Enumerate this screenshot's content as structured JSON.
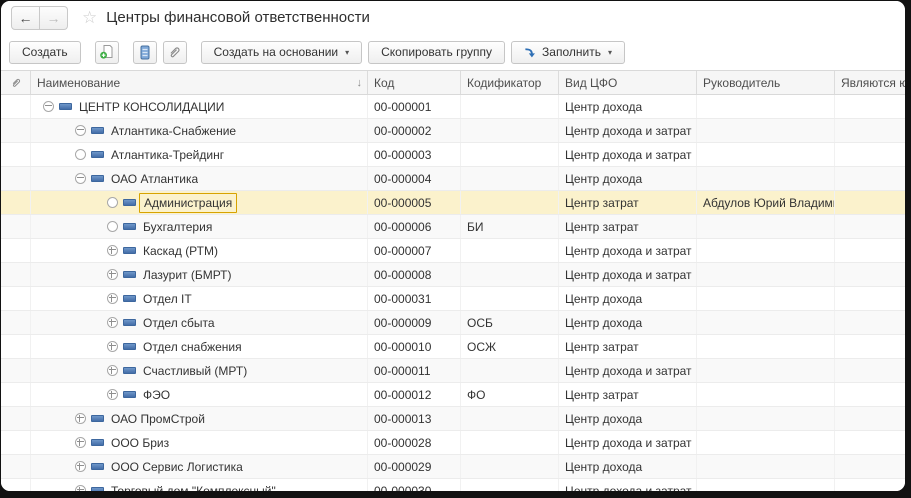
{
  "window": {
    "title": "Центры финансовой ответственности"
  },
  "icons": {
    "back_arrow": "←",
    "forward_arrow": "→",
    "favorite_star": "☆",
    "dropdown_caret": "▾",
    "sort_descending": "↓",
    "attachment": "paperclip-icon",
    "create_group_doc": "document-with-green-plus-icon",
    "list_report": "blue-list-icon",
    "fill": "blue-curved-arrow-icon"
  },
  "toolbar": {
    "create_label": "Создать",
    "create_based_on_label": "Создать на основании",
    "copy_group_label": "Скопировать группу",
    "fill_label": "Заполнить"
  },
  "table": {
    "columns": [
      "",
      "Наименование",
      "Код",
      "Кодификатор",
      "Вид ЦФО",
      "Руководитель",
      "Являются юридическим лицом",
      ""
    ],
    "rows": [
      {
        "name": "ЦЕНТР КОНСОЛИДАЦИИ",
        "level": 1,
        "expander": "minus",
        "code": "00-000001",
        "codifier": "",
        "cfo_type": "Центр дохода",
        "manager": "",
        "selected": false
      },
      {
        "name": "Атлантика-Снабжение",
        "level": 2,
        "expander": "minus",
        "code": "00-000002",
        "codifier": "",
        "cfo_type": "Центр дохода и затрат",
        "manager": "",
        "selected": false
      },
      {
        "name": "Атлантика-Трейдинг",
        "level": 2,
        "expander": "leaf",
        "code": "00-000003",
        "codifier": "",
        "cfo_type": "Центр дохода и затрат",
        "manager": "",
        "selected": false
      },
      {
        "name": "ОАО Атлантика",
        "level": 2,
        "expander": "minus",
        "code": "00-000004",
        "codifier": "",
        "cfo_type": "Центр дохода",
        "manager": "",
        "selected": false
      },
      {
        "name": "Администрация",
        "level": 3,
        "expander": "leaf",
        "code": "00-000005",
        "codifier": "",
        "cfo_type": "Центр затрат",
        "manager": "Абдулов Юрий Владими…",
        "selected": true
      },
      {
        "name": "Бухгалтерия",
        "level": 3,
        "expander": "leaf",
        "code": "00-000006",
        "codifier": "БИ",
        "cfo_type": "Центр затрат",
        "manager": "",
        "selected": false
      },
      {
        "name": "Каскад (РТМ)",
        "level": 3,
        "expander": "plus",
        "code": "00-000007",
        "codifier": "",
        "cfo_type": "Центр дохода и затрат",
        "manager": "",
        "selected": false
      },
      {
        "name": "Лазурит (БМРТ)",
        "level": 3,
        "expander": "plus",
        "code": "00-000008",
        "codifier": "",
        "cfo_type": "Центр дохода и затрат",
        "manager": "",
        "selected": false
      },
      {
        "name": "Отдел IT",
        "level": 3,
        "expander": "plus",
        "code": "00-000031",
        "codifier": "",
        "cfo_type": "Центр дохода",
        "manager": "",
        "selected": false
      },
      {
        "name": "Отдел сбыта",
        "level": 3,
        "expander": "plus",
        "code": "00-000009",
        "codifier": "ОСБ",
        "cfo_type": "Центр дохода",
        "manager": "",
        "selected": false
      },
      {
        "name": "Отдел снабжения",
        "level": 3,
        "expander": "plus",
        "code": "00-000010",
        "codifier": "ОСЖ",
        "cfo_type": "Центр затрат",
        "manager": "",
        "selected": false
      },
      {
        "name": "Счастливый (МРТ)",
        "level": 3,
        "expander": "plus",
        "code": "00-000011",
        "codifier": "",
        "cfo_type": "Центр дохода и затрат",
        "manager": "",
        "selected": false
      },
      {
        "name": "ФЭО",
        "level": 3,
        "expander": "plus",
        "code": "00-000012",
        "codifier": "ФО",
        "cfo_type": "Центр затрат",
        "manager": "",
        "selected": false
      },
      {
        "name": "ОАО ПромСтрой",
        "level": 2,
        "expander": "plus",
        "code": "00-000013",
        "codifier": "",
        "cfo_type": "Центр дохода",
        "manager": "",
        "selected": false
      },
      {
        "name": "ООО Бриз",
        "level": 2,
        "expander": "plus",
        "code": "00-000028",
        "codifier": "",
        "cfo_type": "Центр дохода и затрат",
        "manager": "",
        "selected": false
      },
      {
        "name": "ООО Сервис Логистика",
        "level": 2,
        "expander": "plus",
        "code": "00-000029",
        "codifier": "",
        "cfo_type": "Центр дохода",
        "manager": "",
        "selected": false
      },
      {
        "name": "Торговый дом \"Комплексный\"",
        "level": 2,
        "expander": "plus",
        "code": "00-000030",
        "codifier": "",
        "cfo_type": "Центр дохода и затрат",
        "manager": "",
        "selected": false
      }
    ]
  }
}
